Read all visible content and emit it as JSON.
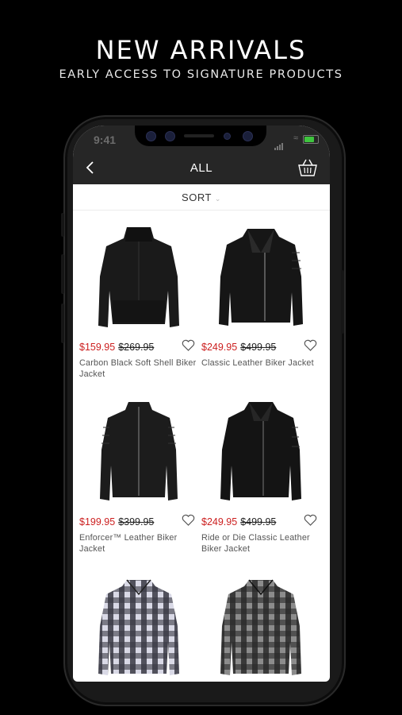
{
  "promo": {
    "title": "NEW ARRIVALS",
    "subtitle": "EARLY ACCESS TO SIGNATURE PRODUCTS"
  },
  "status": {
    "time": "9:41"
  },
  "nav": {
    "title": "ALL",
    "back_icon": "chevron-left-icon",
    "cart_icon": "basket-icon"
  },
  "sort": {
    "label": "SORT",
    "icon": "chevron-down-icon"
  },
  "colors": {
    "sale": "#cc1f1f",
    "bar": "#262626",
    "accent": "#3ec43e"
  },
  "products": [
    {
      "sale_price": "$159.95",
      "original_price": "$269.95",
      "name": "Carbon Black Soft Shell Biker Jacket"
    },
    {
      "sale_price": "$249.95",
      "original_price": "$499.95",
      "name": "Classic Leather Biker Jacket"
    },
    {
      "sale_price": "$199.95",
      "original_price": "$399.95",
      "name": "Enforcer™ Leather Biker Jacket"
    },
    {
      "sale_price": "$249.95",
      "original_price": "$499.95",
      "name": "Ride or Die Classic Leather Biker Jacket"
    },
    {
      "sale_price": "",
      "original_price": "",
      "name": ""
    },
    {
      "sale_price": "",
      "original_price": "",
      "name": ""
    }
  ]
}
